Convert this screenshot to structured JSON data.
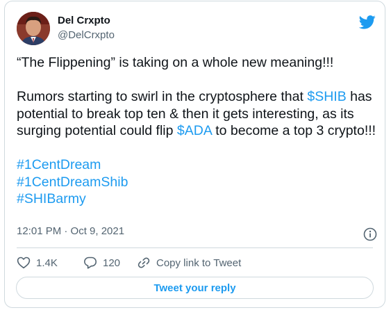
{
  "author": {
    "name": "Del Crxpto",
    "handle": "@DelCrxpto"
  },
  "tweet": {
    "line1": "“The Flippening” is taking on a whole new meaning!!!",
    "para2_part1": "Rumors starting to swirl in the cryptosphere that ",
    "cashtag_shib": "$SHIB",
    "para2_part2": " has potential to break top ten & then it gets interesting, as its surging potential could flip ",
    "cashtag_ada": "$ADA",
    "para2_part3": " to become a top 3 crypto!!!",
    "hashtags": [
      "#1CentDream",
      "#1CentDreamShib",
      "#SHIBarmy"
    ]
  },
  "meta": {
    "timestamp": "12:01 PM · Oct 9, 2021"
  },
  "actions": {
    "likes": "1.4K",
    "replies": "120",
    "copy_link": "Copy link to Tweet"
  },
  "reply_button": "Tweet your reply",
  "colors": {
    "link": "#1d9bf0",
    "text": "#0f1419",
    "secondary": "#536471",
    "border": "#cfd9de"
  },
  "icons": {
    "logo": "twitter-bird-icon",
    "info": "info-icon",
    "like": "heart-icon",
    "reply": "speech-bubble-icon",
    "copy": "link-icon"
  }
}
